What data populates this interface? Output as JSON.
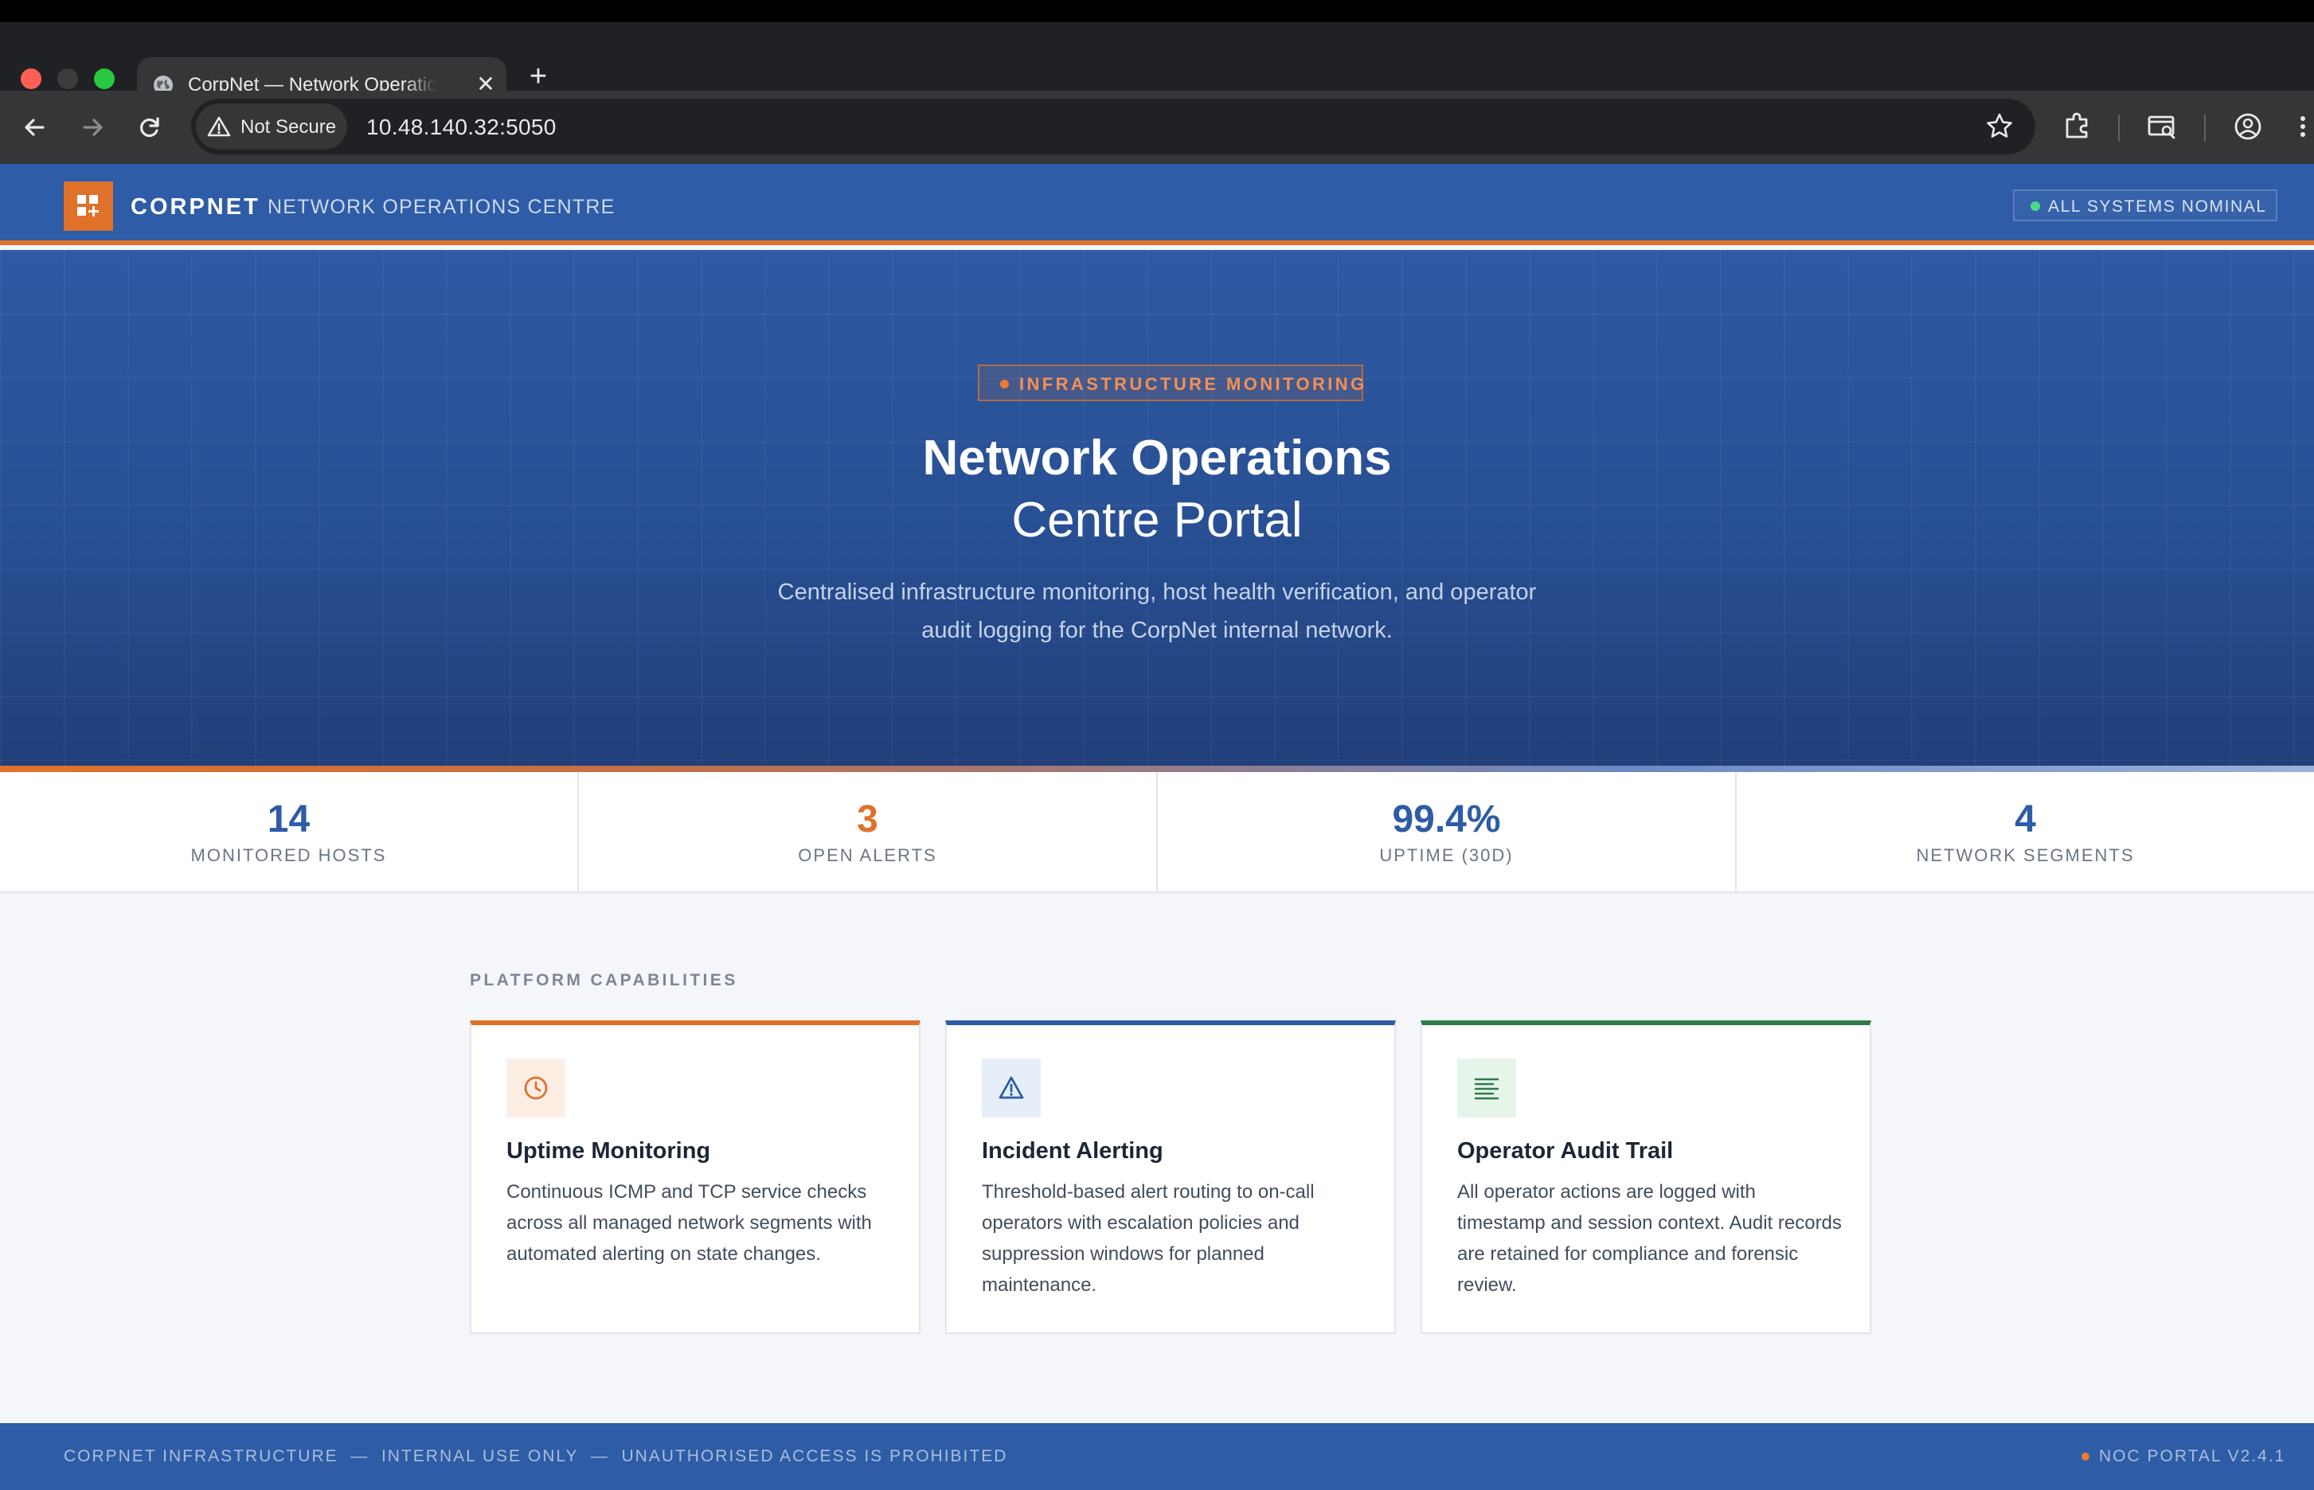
{
  "browser": {
    "tab_title": "CorpNet — Network Operations Centre Portal",
    "security_chip": "Not Secure",
    "url": "10.48.140.32:5050"
  },
  "header": {
    "brand": "CORPNET",
    "subtitle": "NETWORK OPERATIONS CENTRE",
    "status": "ALL SYSTEMS NOMINAL"
  },
  "hero": {
    "badge": "INFRASTRUCTURE MONITORING",
    "title_line1": "Network Operations",
    "title_line2": "Centre Portal",
    "description": "Centralised infrastructure monitoring, host health verification, and operator audit logging for the CorpNet internal network."
  },
  "stats": [
    {
      "value": "14",
      "label": "MONITORED HOSTS"
    },
    {
      "value": "3",
      "label": "OPEN ALERTS"
    },
    {
      "value": "99.4%",
      "label": "UPTIME (30D)"
    },
    {
      "value": "4",
      "label": "NETWORK SEGMENTS"
    }
  ],
  "capabilities": {
    "section_title": "PLATFORM CAPABILITIES",
    "cards": [
      {
        "icon": "clock-icon",
        "title": "Uptime Monitoring",
        "description": "Continuous ICMP and TCP service checks across all managed network segments with automated alerting on state changes."
      },
      {
        "icon": "warning-icon",
        "title": "Incident Alerting",
        "description": "Threshold-based alert routing to on-call operators with escalation policies and suppression windows for planned maintenance."
      },
      {
        "icon": "list-icon",
        "title": "Operator Audit Trail",
        "description": "All operator actions are logged with timestamp and session context. Audit records are retained for compliance and forensic review."
      }
    ]
  },
  "footer": {
    "left": "CORPNET INFRASTRUCTURE  —  INTERNAL USE ONLY  —  UNAUTHORISED ACCESS IS PROHIBITED",
    "right": "NOC PORTAL V2.4.1"
  },
  "colors": {
    "brand_blue": "#2e5ca6",
    "accent_orange": "#e0712b",
    "accent_green": "#2f7a4c",
    "status_green": "#4cd98b"
  }
}
